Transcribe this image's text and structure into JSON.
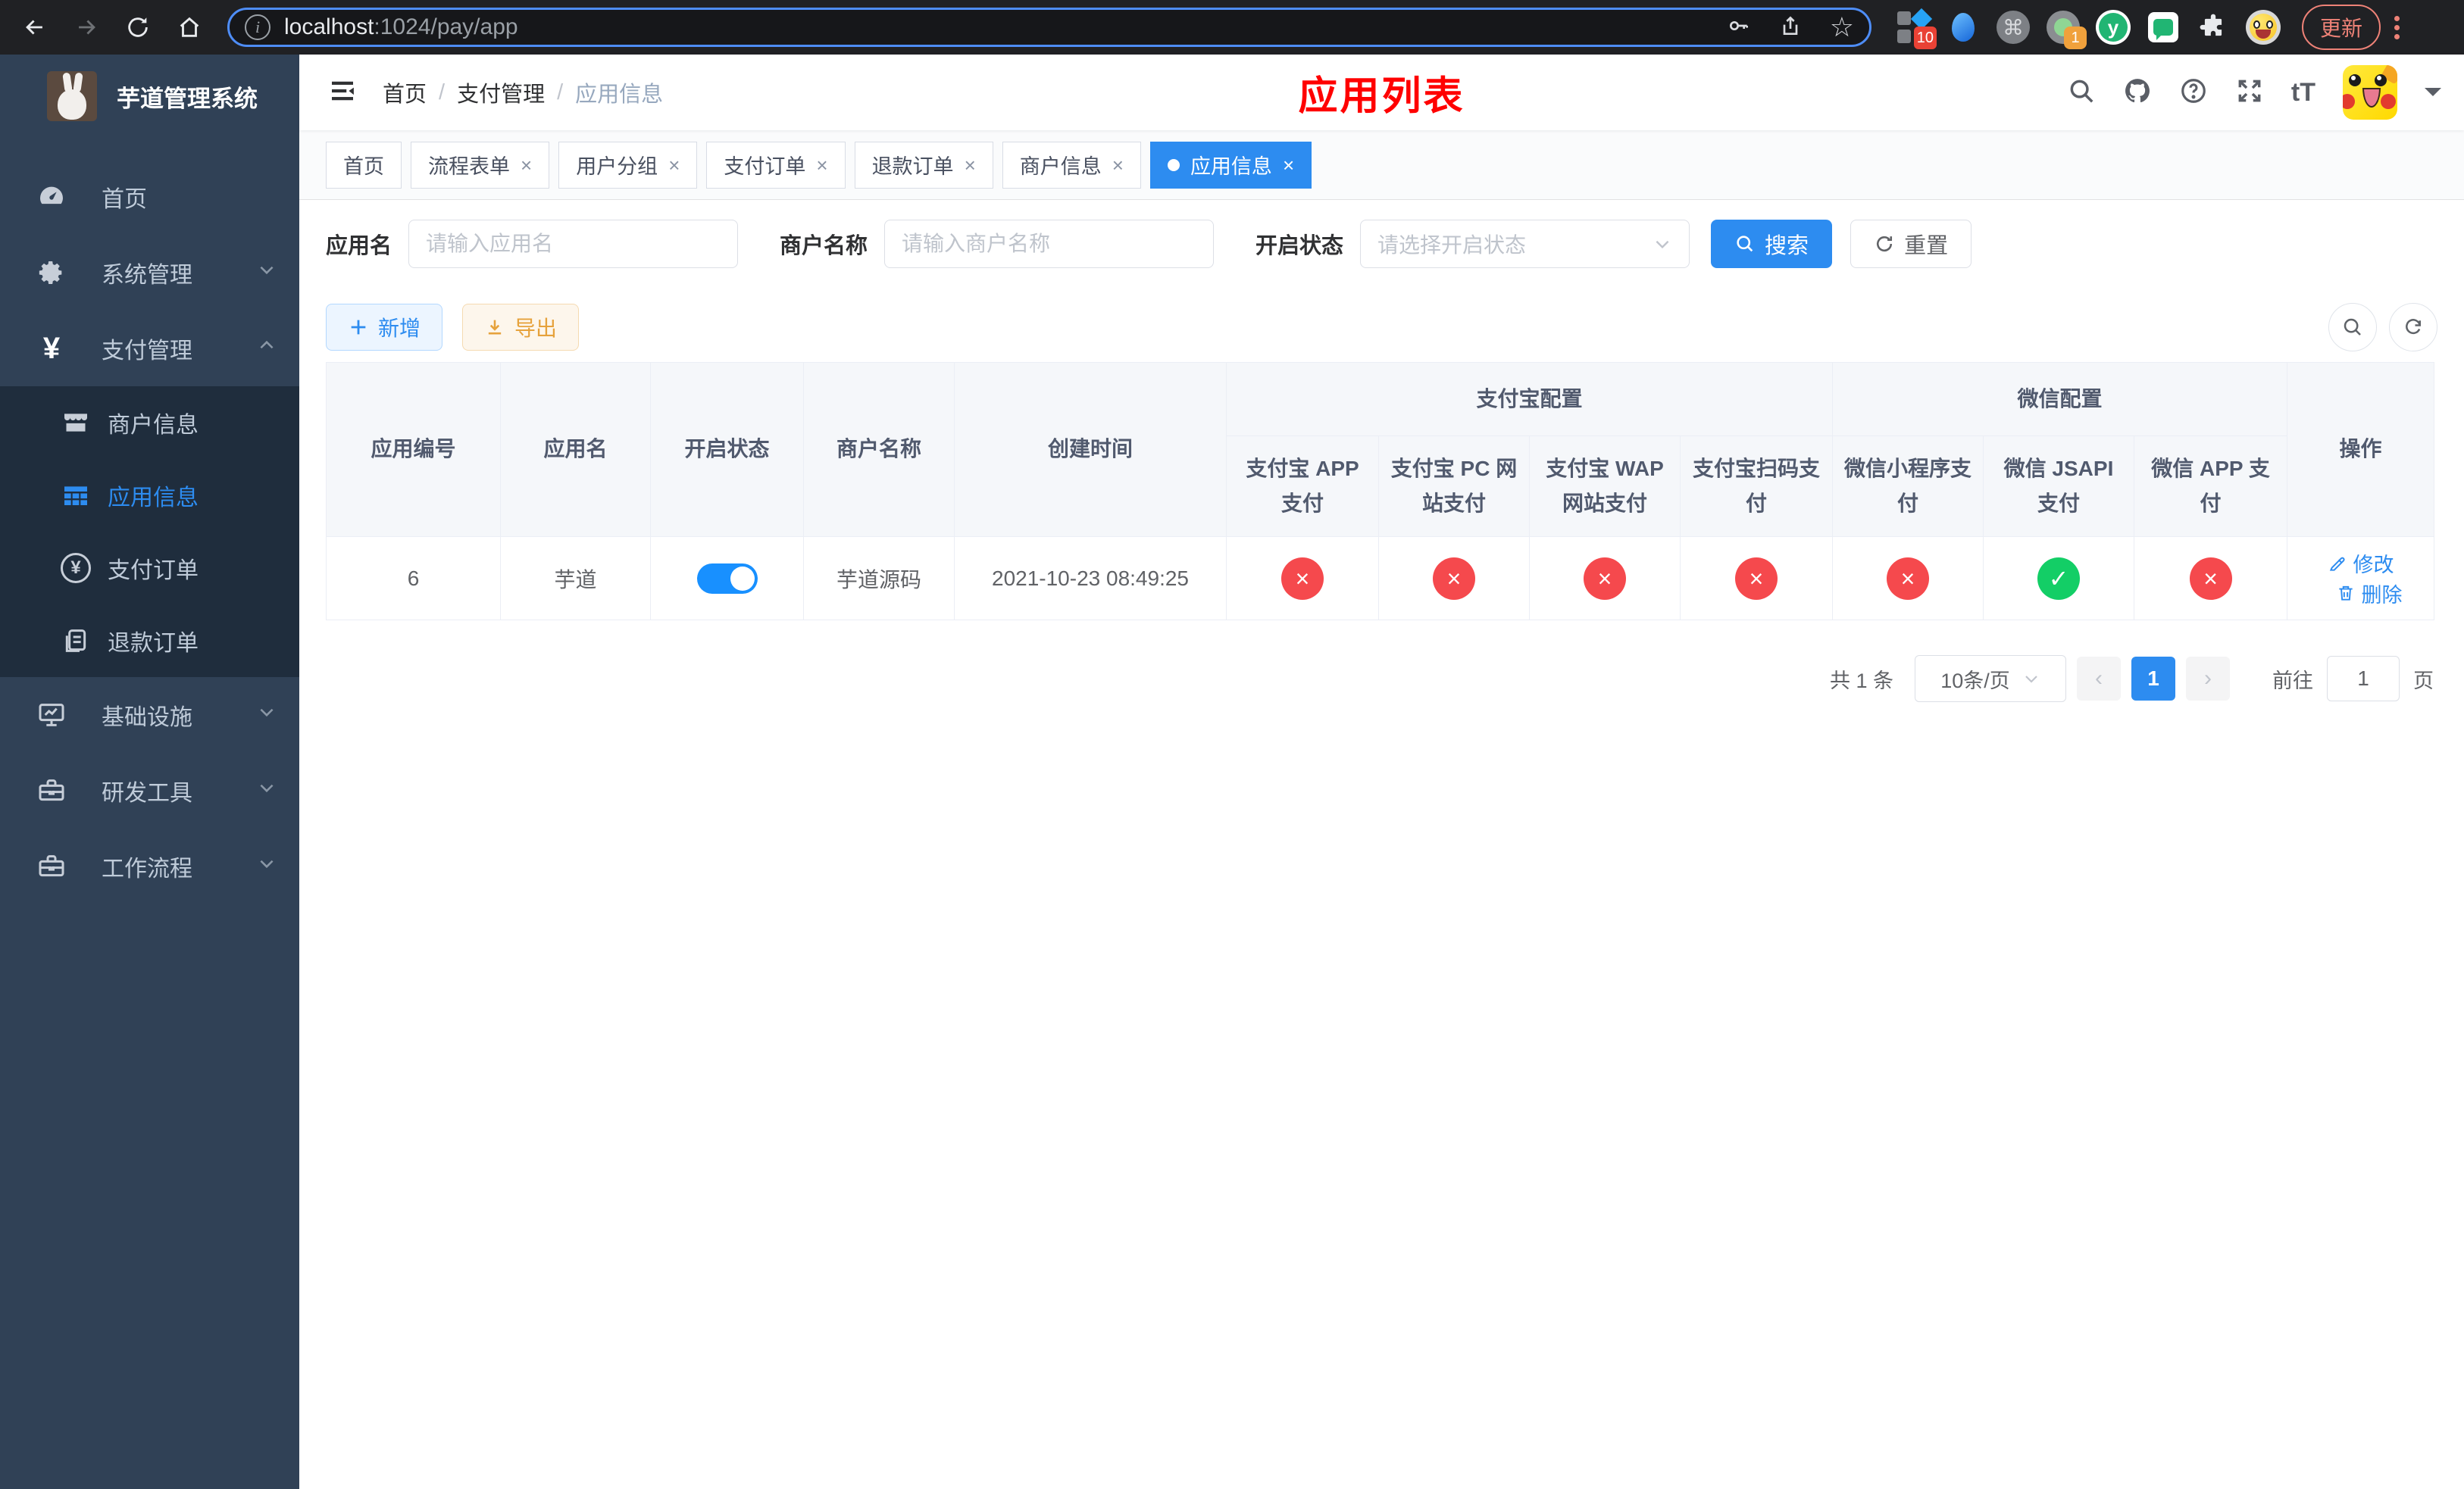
{
  "browser": {
    "url_host": "localhost",
    "url_rest": ":1024/pay/app",
    "update_label": "更新",
    "ext_badges": {
      "sketch": "10",
      "recorder": "1"
    },
    "ext_y_letter": "y",
    "ext_command_glyph": "⌘"
  },
  "sidebar": {
    "title": "芋道管理系统",
    "items": [
      {
        "label": "首页"
      },
      {
        "label": "系统管理"
      },
      {
        "label": "支付管理"
      }
    ],
    "submenu": [
      {
        "label": "商户信息"
      },
      {
        "label": "应用信息"
      },
      {
        "label": "支付订单"
      },
      {
        "label": "退款订单"
      }
    ],
    "groups": [
      {
        "label": "基础设施"
      },
      {
        "label": "研发工具"
      },
      {
        "label": "工作流程"
      }
    ]
  },
  "header": {
    "breadcrumb": [
      "首页",
      "支付管理",
      "应用信息"
    ],
    "annotation_title": "应用列表",
    "font_size_icon": "tT"
  },
  "tabs": [
    {
      "label": "首页"
    },
    {
      "label": "流程表单"
    },
    {
      "label": "用户分组"
    },
    {
      "label": "支付订单"
    },
    {
      "label": "退款订单"
    },
    {
      "label": "商户信息"
    },
    {
      "label": "应用信息"
    }
  ],
  "filters": {
    "fields": [
      {
        "label": "应用名",
        "placeholder": "请输入应用名"
      },
      {
        "label": "商户名称",
        "placeholder": "请输入商户名称"
      },
      {
        "label": "开启状态",
        "placeholder": "请选择开启状态"
      }
    ],
    "search_label": "搜索",
    "reset_label": "重置"
  },
  "toolbar": {
    "add_label": "新增",
    "export_label": "导出"
  },
  "table": {
    "columns": [
      "应用编号",
      "应用名",
      "开启状态",
      "商户名称",
      "创建时间"
    ],
    "group_alipay": "支付宝配置",
    "group_wechat": "微信配置",
    "alipay_columns": [
      "支付宝 APP 支付",
      "支付宝 PC 网站支付",
      "支付宝 WAP 网站支付",
      "支付宝扫码支付"
    ],
    "wechat_columns": [
      "微信小程序支付",
      "微信 JSAPI 支付",
      "微信 APP 支付"
    ],
    "ops_column": "操作",
    "row": {
      "id": "6",
      "name": "芋道",
      "enabled": true,
      "merchant": "芋道源码",
      "created": "2021-10-23 08:49:25",
      "channels": [
        false,
        false,
        false,
        false,
        false,
        true,
        false
      ],
      "edit_label": "修改",
      "delete_label": "删除"
    }
  },
  "pagination": {
    "total_text": "共 1 条",
    "page_size": "10条/页",
    "prev": "‹",
    "current_page": "1",
    "next": "›",
    "goto_label": "前往",
    "goto_value": "1",
    "goto_suffix": "页"
  },
  "colors": {
    "primary": "#2d8cf0",
    "toggle_on": "#1890ff",
    "status_off": "#f5494d",
    "status_on": "#13ce66",
    "sidebar_bg": "#304156",
    "submenu_bg": "#1f2d3d",
    "annotation_red": "#ff0000",
    "export_orange": "#e6a23c",
    "browser_bar_bg": "#202124"
  }
}
